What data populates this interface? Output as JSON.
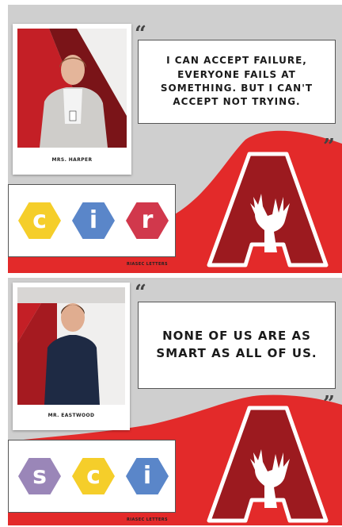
{
  "colors": {
    "red": "#e32a2a",
    "dark_red": "#9c1a1f",
    "gray": "#cfcfcf",
    "yellow": "#f5ce2a",
    "blue": "#5a86c9",
    "crimson": "#d1384c",
    "purple": "#9a86b8"
  },
  "cards": [
    {
      "caption": "MRS. HARPER",
      "quote_lines": [
        "I CAN ACCEPT FAILURE,",
        "EVERYONE FAILS AT",
        "SOMETHING. BUT I CAN'T",
        "ACCEPT NOT TRYING."
      ],
      "riasec_letters": [
        {
          "letter": "c",
          "color": "#f5ce2a"
        },
        {
          "letter": "i",
          "color": "#5a86c9"
        },
        {
          "letter": "r",
          "color": "#d1384c"
        }
      ],
      "riasec_label": "RIASEC LETTERS"
    },
    {
      "caption": "MR. EASTWOOD",
      "quote_lines": [
        "NONE OF US ARE AS",
        "SMART AS ALL OF US."
      ],
      "riasec_letters": [
        {
          "letter": "s",
          "color": "#9a86b8"
        },
        {
          "letter": "c",
          "color": "#f5ce2a"
        },
        {
          "letter": "i",
          "color": "#5a86c9"
        }
      ],
      "riasec_label": "RIASEC LETTERS"
    }
  ],
  "icons": {
    "open_quote": "open-quote-icon",
    "close_quote": "close-quote-icon",
    "logo": "a-stag-logo"
  }
}
